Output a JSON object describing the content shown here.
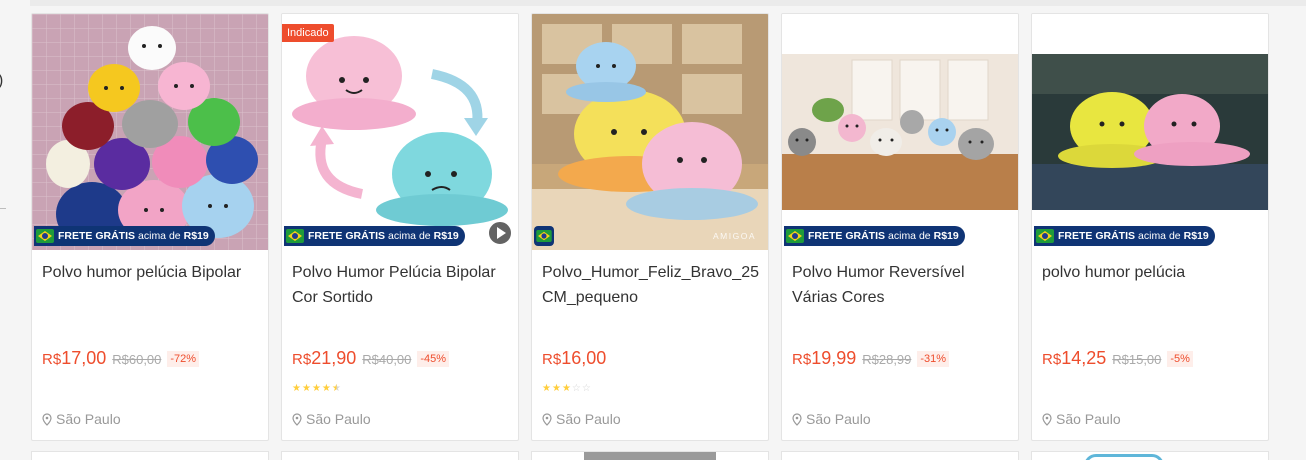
{
  "products": [
    {
      "title": "Polvo humor pelúcia Bipolar",
      "currency": "R$",
      "price": "17,00",
      "old_price": "R$60,00",
      "discount": "-72%",
      "location": "São Paulo",
      "shipping": {
        "label": "FRETE GRÁTIS",
        "detail": "acima de",
        "amount": "R$19"
      },
      "rating": null
    },
    {
      "badge": "Indicado",
      "title": "Polvo Humor Pelúcia Bipolar Cor Sortido",
      "currency": "R$",
      "price": "21,90",
      "old_price": "R$40,00",
      "discount": "-45%",
      "location": "São Paulo",
      "shipping": {
        "label": "FRETE GRÁTIS",
        "detail": "acima de",
        "amount": "R$19"
      },
      "rating": 4.5,
      "has_video": true
    },
    {
      "title": "Polvo_Humor_Feliz_Bravo_25CM_pequeno",
      "currency": "R$",
      "price": "16,00",
      "location": "São Paulo",
      "watermark": "AMIGOA",
      "rating": 3
    },
    {
      "title": "Polvo Humor Reversível Várias Cores",
      "currency": "R$",
      "price": "19,99",
      "old_price": "R$28,99",
      "discount": "-31%",
      "location": "São Paulo",
      "shipping": {
        "label": "FRETE GRÁTIS",
        "detail": "acima de",
        "amount": "R$19"
      },
      "rating": null
    },
    {
      "title": "polvo humor pelúcia",
      "currency": "R$",
      "price": "14,25",
      "old_price": "R$15,00",
      "discount": "-5%",
      "location": "São Paulo",
      "shipping": {
        "label": "FRETE GRÁTIS",
        "detail": "acima de",
        "amount": "R$19"
      },
      "rating": null
    }
  ],
  "sidebar": {
    "partial_text": ")"
  },
  "colors": {
    "accent": "#ee4d2d",
    "shipping_badge": "#0f3475",
    "star": "#ffce3d"
  },
  "icons": [
    "brazil-flag-icon",
    "play-icon",
    "location-pin-icon",
    "star-icon"
  ]
}
